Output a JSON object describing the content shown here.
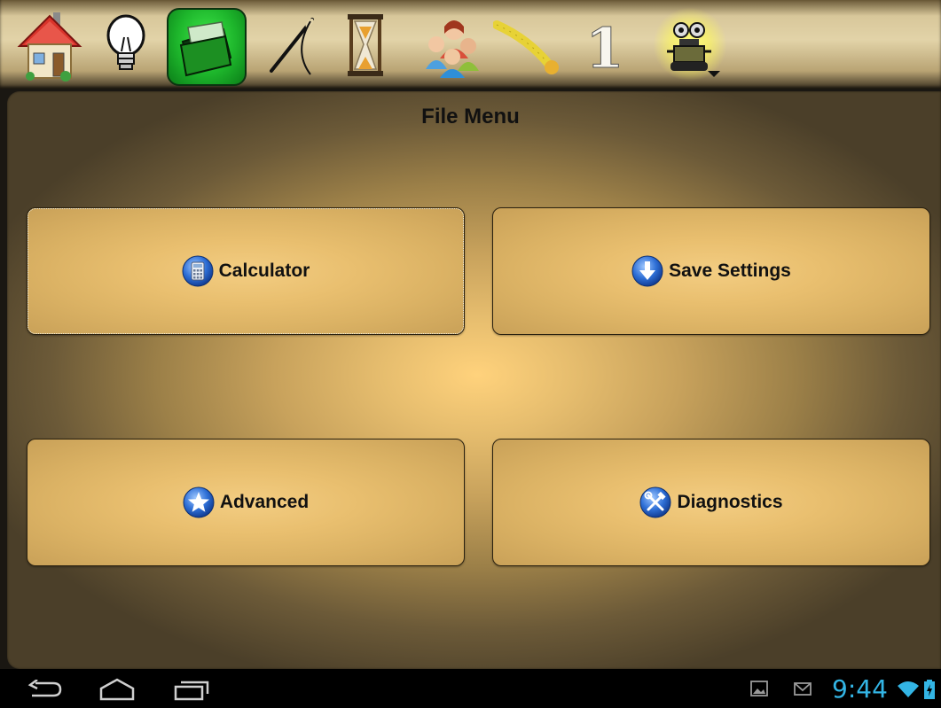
{
  "toolbar": {
    "icons": [
      {
        "name": "house-icon"
      },
      {
        "name": "lightbulb-icon"
      },
      {
        "name": "folder-icon",
        "selected": true
      },
      {
        "name": "needle-thread-icon"
      },
      {
        "name": "hourglass-icon"
      },
      {
        "name": "people-icon"
      },
      {
        "name": "measuring-tape-icon"
      },
      {
        "name": "number-one-icon",
        "text": "1"
      },
      {
        "name": "robot-icon",
        "has_dropdown": true
      }
    ],
    "selected_color": "#1db52b"
  },
  "page": {
    "title": "File Menu"
  },
  "buttons": {
    "calculator": {
      "label": "Calculator",
      "icon": "calculator-icon"
    },
    "save_settings": {
      "label": "Save Settings",
      "icon": "download-arrow-icon"
    },
    "advanced": {
      "label": "Advanced",
      "icon": "star-icon"
    },
    "diagnostics": {
      "label": "Diagnostics",
      "icon": "wrench-hammer-icon"
    }
  },
  "system_bar": {
    "time": "9:44",
    "time_color": "#33b5e5",
    "nav": [
      "back-icon",
      "home-icon",
      "recent-apps-icon"
    ],
    "notifications": [
      "gallery-icon",
      "gmail-icon",
      "wifi-icon",
      "battery-charging-icon"
    ]
  }
}
